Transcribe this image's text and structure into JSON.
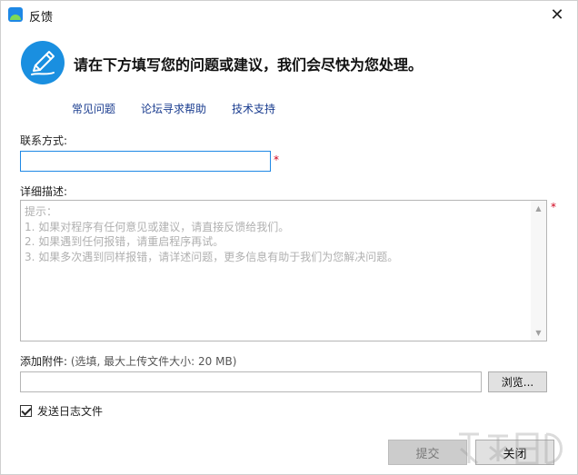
{
  "window": {
    "title": "反馈",
    "close_glyph": "✕"
  },
  "header": {
    "icon": "pen-edit-icon",
    "headline": "请在下方填写您的问题或建议，我们会尽快为您处理。"
  },
  "links": {
    "faq": "常见问题",
    "forum": "论坛寻求帮助",
    "support": "技术支持"
  },
  "contact": {
    "label": "联系方式:",
    "value": "",
    "required_mark": "*"
  },
  "detail": {
    "label": "详细描述:",
    "required_mark": "*",
    "placeholder_lines": [
      "提示：",
      "1. 如果对程序有任何意见或建议，请直接反馈给我们。",
      "2. 如果遇到任何报错，请重启程序再试。",
      "3. 如果多次遇到同样报错，请详述问题，更多信息有助于我们为您解决问题。"
    ]
  },
  "attachment": {
    "label": "添加附件:",
    "hint": "(选填, 最大上传文件大小: 20 MB)",
    "value": "",
    "browse_label": "浏览..."
  },
  "send_log": {
    "label": "发送日志文件",
    "checked": true
  },
  "buttons": {
    "submit": "提交",
    "close": "关闭"
  },
  "colors": {
    "accent": "#1e88e5",
    "required": "#d0021b",
    "link": "#1a3c8f"
  }
}
